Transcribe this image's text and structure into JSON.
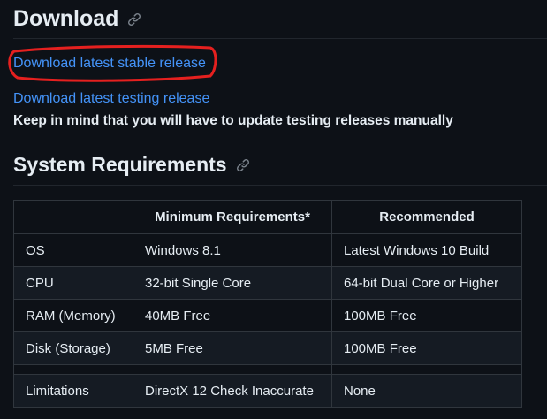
{
  "download": {
    "heading": "Download",
    "stable_link": "Download latest stable release",
    "testing_link": "Download latest testing release",
    "testing_note": "Keep in mind that you will have to update testing releases manually"
  },
  "system_requirements": {
    "heading": "System Requirements",
    "headers": [
      "",
      "Minimum Requirements*",
      "Recommended"
    ],
    "rows": [
      [
        "OS",
        "Windows 8.1",
        "Latest Windows 10 Build"
      ],
      [
        "CPU",
        "32-bit Single Core",
        "64-bit Dual Core or Higher"
      ],
      [
        "RAM (Memory)",
        "40MB Free",
        "100MB Free"
      ],
      [
        "Disk (Storage)",
        "5MB Free",
        "100MB Free"
      ],
      [
        "",
        "",
        ""
      ],
      [
        "Limitations",
        "DirectX 12 Check Inaccurate",
        "None"
      ]
    ]
  },
  "colors": {
    "background": "#0d1117",
    "text": "#e6edf3",
    "link": "#4493f8",
    "border": "#30363d",
    "annotation": "#e5201f"
  },
  "icons": {
    "anchor": "link-icon"
  }
}
